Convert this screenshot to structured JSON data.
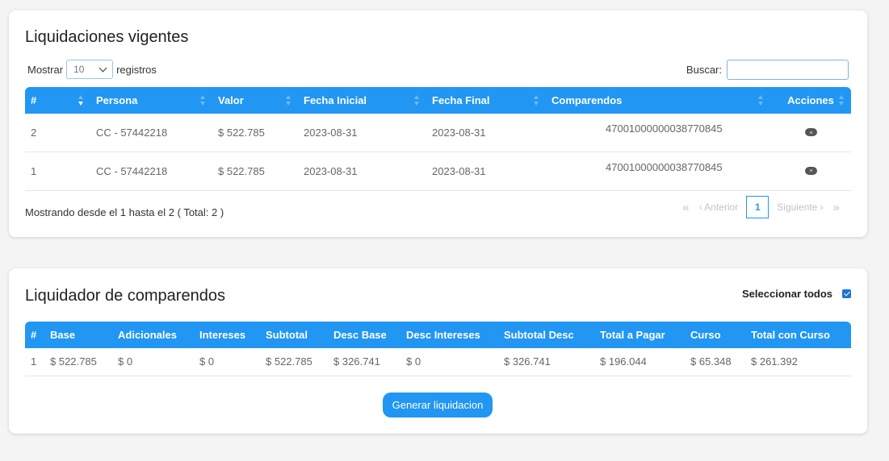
{
  "liquidaciones": {
    "title": "Liquidaciones vigentes",
    "show_label": "Mostrar",
    "length_value": "10",
    "records_label": "registros",
    "search_label": "Buscar:",
    "search_value": "",
    "headers": [
      "#",
      "Persona",
      "Valor",
      "Fecha Inicial",
      "Fecha Final",
      "Comparendos",
      "Acciones"
    ],
    "rows": [
      {
        "num": "2",
        "persona": "CC - 57442218",
        "valor": "$ 522.785",
        "fecha_inicial": "2023-08-31",
        "fecha_final": "2023-08-31",
        "comparendos": "47001000000038770845",
        "action_icon": "eye-icon"
      },
      {
        "num": "1",
        "persona": "CC - 57442218",
        "valor": "$ 522.785",
        "fecha_inicial": "2023-08-31",
        "fecha_final": "2023-08-31",
        "comparendos": "47001000000038770845",
        "action_icon": "eye-icon"
      }
    ],
    "info_text": "Mostrando desde el 1 hasta el 2 ( Total: 2 )",
    "pagination": {
      "first": "«",
      "prev": "‹ Anterior",
      "current": "1",
      "next": "Siguiente ›",
      "last": "»"
    }
  },
  "liquidador": {
    "title": "Liquidador de comparendos",
    "select_all_label": "Seleccionar todos",
    "select_all_checked": true,
    "headers": [
      "#",
      "Base",
      "Adicionales",
      "Intereses",
      "Subtotal",
      "Desc Base",
      "Desc Intereses",
      "Subtotal Desc",
      "Total a Pagar",
      "Curso",
      "Total con Curso"
    ],
    "rows": [
      [
        "1",
        "$ 522.785",
        "$ 0",
        "$ 0",
        "$ 522.785",
        "$ 326.741",
        "$ 0",
        "$ 326.741",
        "$ 196.044",
        "$ 65.348",
        "$ 261.392"
      ]
    ],
    "generate_button": "Generar liquidacion"
  },
  "colors": {
    "accent": "#2196f3",
    "background": "#f4f4f5",
    "card": "#ffffff"
  }
}
